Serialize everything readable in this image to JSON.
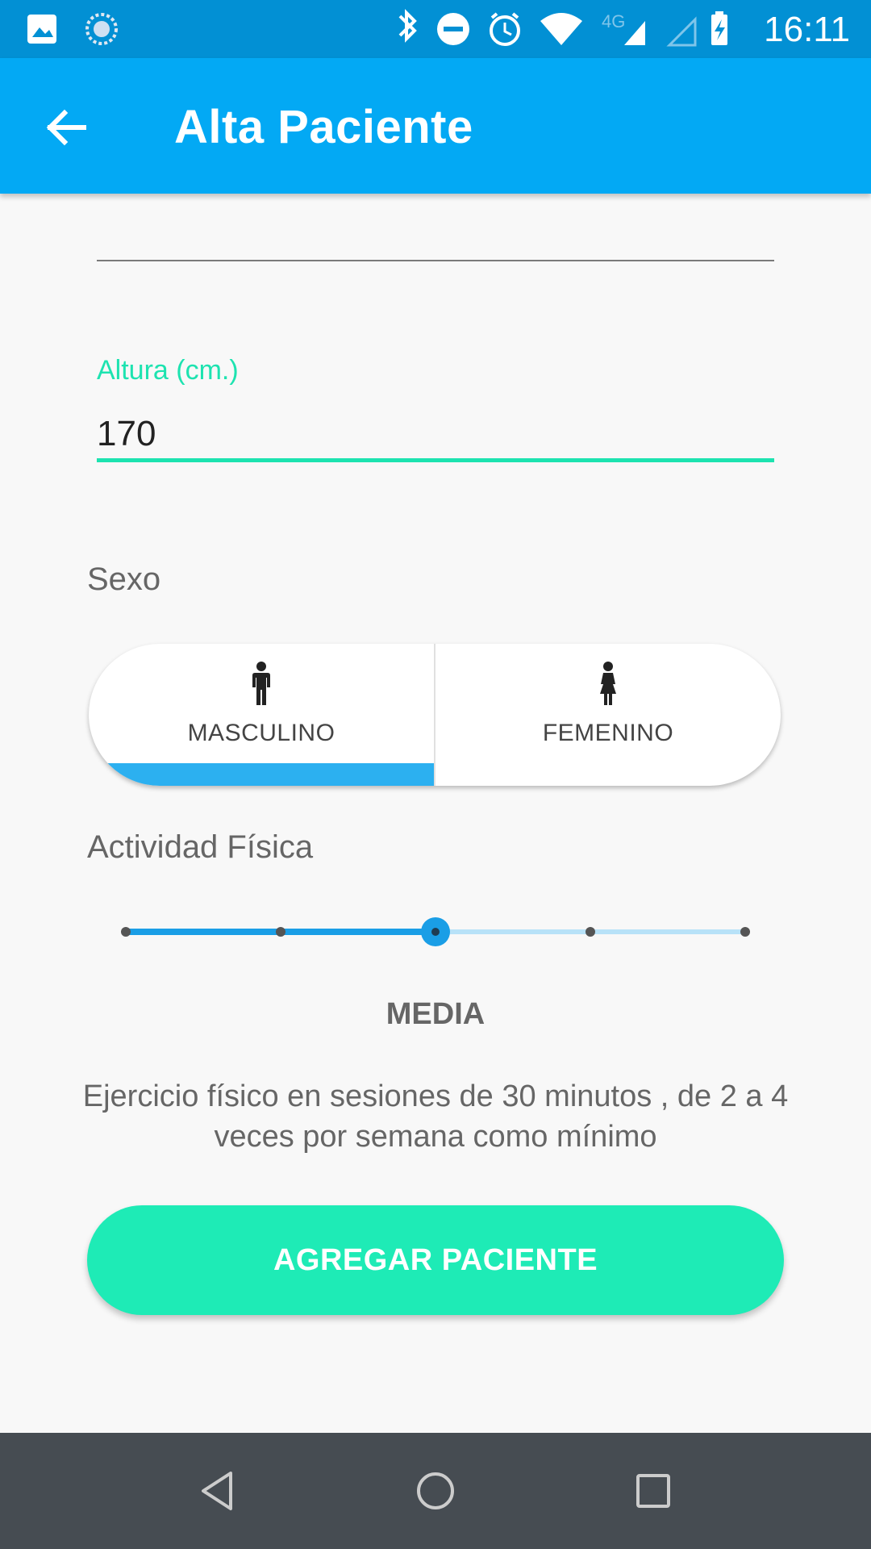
{
  "status_bar": {
    "time": "16:11",
    "network": "4G",
    "icons": [
      "gallery-icon",
      "sync-icon",
      "bluetooth-icon",
      "do-not-disturb-icon",
      "alarm-icon",
      "wifi-icon",
      "signal-icon",
      "signal-icon-2",
      "battery-charging-icon"
    ]
  },
  "app_bar": {
    "title": "Alta Paciente",
    "back_icon": "arrow-back-icon"
  },
  "form": {
    "height_label": "Altura (cm.)",
    "height_value": "170",
    "sex_label": "Sexo",
    "sex_options": [
      {
        "label": "MASCULINO",
        "icon": "male-icon",
        "selected": true
      },
      {
        "label": "FEMENINO",
        "icon": "female-icon",
        "selected": false
      }
    ],
    "activity_label": "Actividad Física",
    "activity_level": {
      "steps": 5,
      "selected_index": 2,
      "label": "MEDIA",
      "description": "Ejercicio físico en sesiones de 30 minutos , de 2 a 4 veces por semana como mínimo"
    }
  },
  "actions": {
    "add_patient": "AGREGAR PACIENTE"
  },
  "colors": {
    "status_bar": "#0290d4",
    "app_bar": "#03a9f4",
    "accent_teal": "#1de3b0",
    "slider_blue": "#1a9ee6",
    "nav_bar": "#464c52"
  }
}
